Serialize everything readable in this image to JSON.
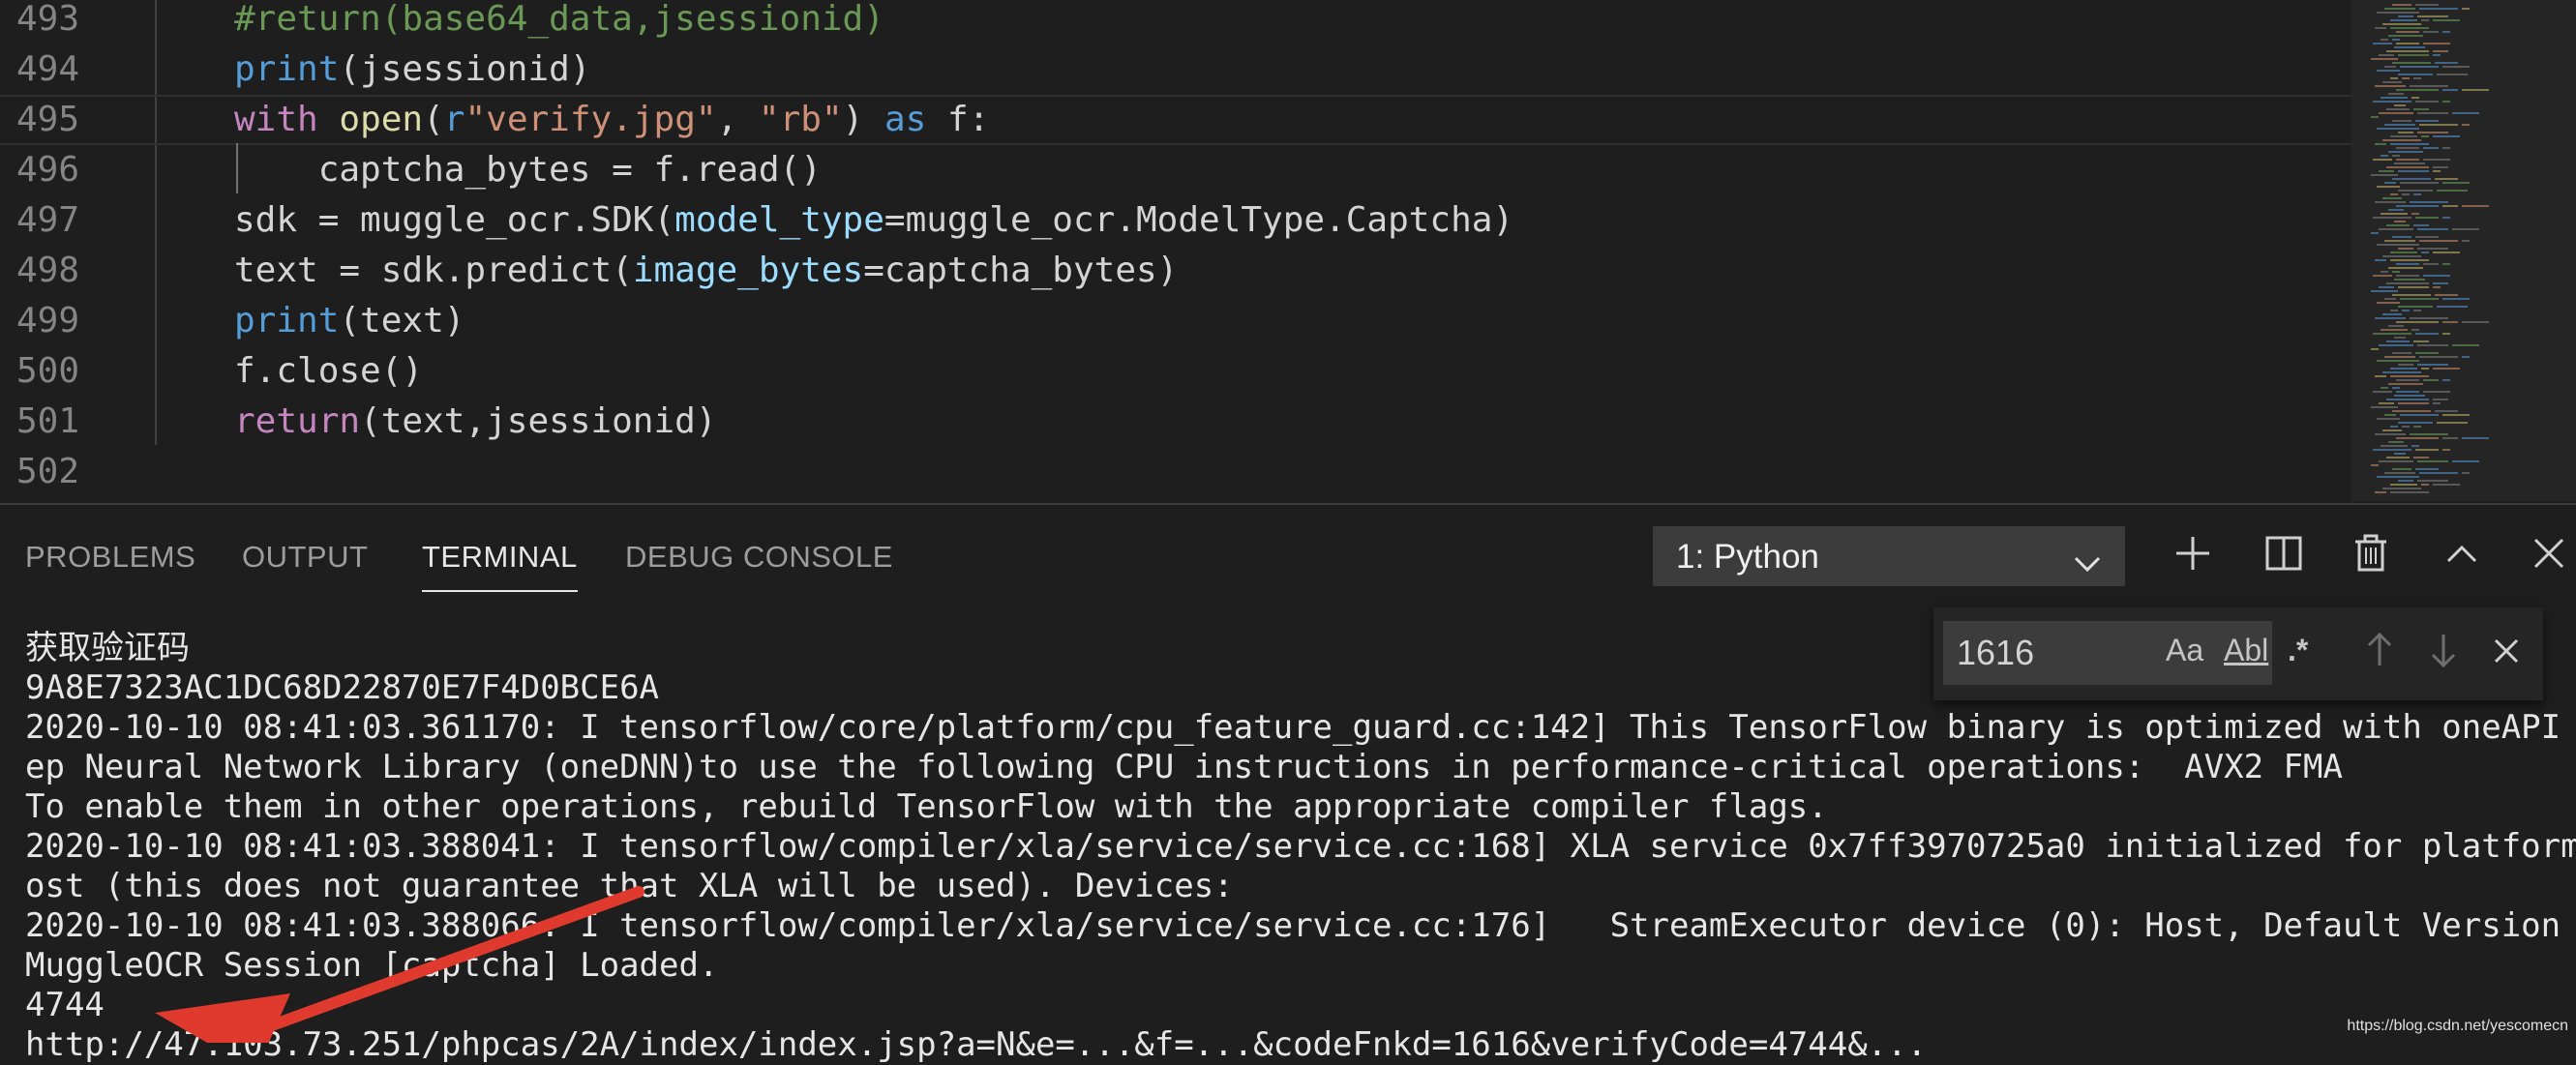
{
  "editor": {
    "lines": [
      {
        "num": "493",
        "tokens": [
          {
            "t": "#return(base64_data,jsessionid)",
            "c": "cmt"
          }
        ]
      },
      {
        "num": "494",
        "tokens": [
          {
            "t": "print",
            "c": "kw"
          },
          {
            "t": "(jsessionid)",
            "c": ""
          }
        ]
      },
      {
        "num": "495",
        "tokens": [
          {
            "t": "with",
            "c": "kw-ctrl"
          },
          {
            "t": " ",
            "c": ""
          },
          {
            "t": "open",
            "c": "fn"
          },
          {
            "t": "(",
            "c": ""
          },
          {
            "t": "r",
            "c": "kw"
          },
          {
            "t": "\"verify.jpg\"",
            "c": "str"
          },
          {
            "t": ", ",
            "c": ""
          },
          {
            "t": "\"rb\"",
            "c": "str"
          },
          {
            "t": ") ",
            "c": ""
          },
          {
            "t": "as",
            "c": "kw"
          },
          {
            "t": " f:",
            "c": ""
          }
        ]
      },
      {
        "num": "496",
        "tokens": [
          {
            "t": "    captcha_bytes = f.read()",
            "c": ""
          }
        ]
      },
      {
        "num": "497",
        "tokens": [
          {
            "t": "sdk = muggle_ocr.SDK(",
            "c": ""
          },
          {
            "t": "model_type",
            "c": "param"
          },
          {
            "t": "=muggle_ocr.ModelType.Captcha)",
            "c": ""
          }
        ]
      },
      {
        "num": "498",
        "tokens": [
          {
            "t": "text = sdk.predict(",
            "c": ""
          },
          {
            "t": "image_bytes",
            "c": "param"
          },
          {
            "t": "=captcha_bytes)",
            "c": ""
          }
        ]
      },
      {
        "num": "499",
        "tokens": [
          {
            "t": "print",
            "c": "kw"
          },
          {
            "t": "(text)",
            "c": ""
          }
        ]
      },
      {
        "num": "500",
        "tokens": [
          {
            "t": "f.close()",
            "c": ""
          }
        ]
      },
      {
        "num": "501",
        "tokens": [
          {
            "t": "return",
            "c": "kw-ctrl"
          },
          {
            "t": "(text,jsessionid)",
            "c": ""
          }
        ]
      },
      {
        "num": "502",
        "tokens": []
      }
    ]
  },
  "panel": {
    "tabs": [
      {
        "label": "PROBLEMS",
        "active": false
      },
      {
        "label": "OUTPUT",
        "active": false
      },
      {
        "label": "TERMINAL",
        "active": true
      },
      {
        "label": "DEBUG CONSOLE",
        "active": false
      }
    ],
    "terminal_select": "1: Python",
    "icons": [
      "plus-icon",
      "split-icon",
      "trash-icon",
      "chevron-up-icon",
      "close-icon"
    ]
  },
  "find": {
    "value": "1616",
    "match_case": "Aa",
    "whole_word": "Abl",
    "regex": ".*"
  },
  "terminal": {
    "lines": [
      "获取验证码",
      "9A8E7323AC1DC68D22870E7F4D0BCE6A",
      "2020-10-10 08:41:03.361170: I tensorflow/core/platform/cpu_feature_guard.cc:142] This TensorFlow binary is optimized with oneAPI De",
      "ep Neural Network Library (oneDNN)to use the following CPU instructions in performance-critical operations:  AVX2 FMA",
      "To enable them in other operations, rebuild TensorFlow with the appropriate compiler flags.",
      "2020-10-10 08:41:03.388041: I tensorflow/compiler/xla/service/service.cc:168] XLA service 0x7ff3970725a0 initialized for platform H",
      "ost (this does not guarantee that XLA will be used). Devices:",
      "2020-10-10 08:41:03.388066: I tensorflow/compiler/xla/service/service.cc:176]   StreamExecutor device (0): Host, Default Version",
      "MuggleOCR Session [captcha] Loaded.",
      "4744",
      "http://47.103.73.251/phpcas/2A/index/index.jsp?a=N&e=...&f=...&codeFnkd=1616&verifyCode=4744&..."
    ]
  },
  "watermark": "https://blog.csdn.net/yescomecn"
}
